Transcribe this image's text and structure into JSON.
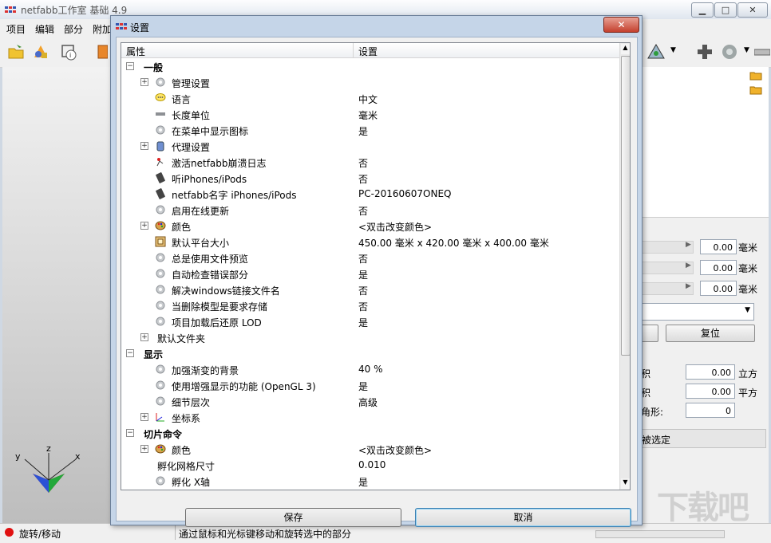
{
  "app": {
    "title": "netfabb工作室 基础 4.9",
    "menus": [
      "项目",
      "编辑",
      "部分",
      "附加"
    ]
  },
  "dialog": {
    "title": "设置",
    "close_label": "✕",
    "columns": {
      "property": "属性",
      "setting": "设置"
    },
    "rows": [
      {
        "label": "一般",
        "value": "",
        "level": 0,
        "type": "section",
        "expander": "−",
        "icon": ""
      },
      {
        "label": "管理设置",
        "value": "",
        "level": 1,
        "type": "item",
        "expander": "+",
        "icon": "gear-icon"
      },
      {
        "label": "语言",
        "value": "中文",
        "level": 1,
        "type": "item",
        "expander": "",
        "icon": "speech-bubble-icon"
      },
      {
        "label": "长度单位",
        "value": "毫米",
        "level": 1,
        "type": "item",
        "expander": "",
        "icon": "ruler-icon"
      },
      {
        "label": "在菜单中显示图标",
        "value": "是",
        "level": 1,
        "type": "item",
        "expander": "",
        "icon": "gear-icon"
      },
      {
        "label": "代理设置",
        "value": "",
        "level": 1,
        "type": "item",
        "expander": "+",
        "icon": "database-icon"
      },
      {
        "label": "激活netfabb崩溃日志",
        "value": "否",
        "level": 1,
        "type": "item",
        "expander": "",
        "icon": "crash-log-icon"
      },
      {
        "label": "听iPhones/iPods",
        "value": "否",
        "level": 1,
        "type": "item",
        "expander": "",
        "icon": "phone-icon"
      },
      {
        "label": "netfabb名字 iPhones/iPods",
        "value": "PC-20160607ONEQ",
        "level": 1,
        "type": "item",
        "expander": "",
        "icon": "phone-icon"
      },
      {
        "label": "启用在线更新",
        "value": "否",
        "level": 1,
        "type": "item",
        "expander": "",
        "icon": "gear-icon"
      },
      {
        "label": "颜色",
        "value": "<双击改变颜色>",
        "level": 1,
        "type": "item",
        "expander": "+",
        "icon": "palette-icon"
      },
      {
        "label": "默认平台大小",
        "value": "450.00 毫米 x 420.00 毫米 x 400.00 毫米",
        "level": 1,
        "type": "item",
        "expander": "",
        "icon": "platform-icon"
      },
      {
        "label": "总是使用文件预览",
        "value": "否",
        "level": 1,
        "type": "item",
        "expander": "",
        "icon": "gear-icon"
      },
      {
        "label": "自动检查错误部分",
        "value": "是",
        "level": 1,
        "type": "item",
        "expander": "",
        "icon": "gear-icon"
      },
      {
        "label": "解决windows链接文件名",
        "value": "否",
        "level": 1,
        "type": "item",
        "expander": "",
        "icon": "gear-icon"
      },
      {
        "label": "当删除模型是要求存储",
        "value": "否",
        "level": 1,
        "type": "item",
        "expander": "",
        "icon": "gear-icon"
      },
      {
        "label": "项目加载后还原 LOD",
        "value": "是",
        "level": 1,
        "type": "item",
        "expander": "",
        "icon": "gear-icon"
      },
      {
        "label": "默认文件夹",
        "value": "",
        "level": 1,
        "type": "item-noicon",
        "expander": "+",
        "icon": ""
      },
      {
        "label": "显示",
        "value": "",
        "level": 0,
        "type": "section",
        "expander": "−",
        "icon": ""
      },
      {
        "label": "加强渐变的背景",
        "value": "40 %",
        "level": 1,
        "type": "item",
        "expander": "",
        "icon": "gear-icon"
      },
      {
        "label": "使用增强显示的功能 (OpenGL 3)",
        "value": "是",
        "level": 1,
        "type": "item",
        "expander": "",
        "icon": "gear-icon"
      },
      {
        "label": "细节层次",
        "value": "高级",
        "level": 1,
        "type": "item",
        "expander": "",
        "icon": "gear-icon"
      },
      {
        "label": "坐标系",
        "value": "",
        "level": 1,
        "type": "item",
        "expander": "+",
        "icon": "axes-icon"
      },
      {
        "label": "切片命令",
        "value": "",
        "level": 0,
        "type": "section",
        "expander": "−",
        "icon": ""
      },
      {
        "label": "颜色",
        "value": "<双击改变颜色>",
        "level": 1,
        "type": "item",
        "expander": "+",
        "icon": "palette-icon"
      },
      {
        "label": "孵化网格尺寸",
        "value": "0.010",
        "level": 1,
        "type": "item-noicon",
        "expander": "",
        "icon": ""
      },
      {
        "label": "孵化 X轴",
        "value": "是",
        "level": 1,
        "type": "item",
        "expander": "",
        "icon": "gear-icon"
      }
    ],
    "buttons": {
      "save": "保存",
      "cancel": "取消"
    }
  },
  "right_panel": {
    "fields": [
      {
        "value": "0.00",
        "unit": "毫米"
      },
      {
        "value": "0.00",
        "unit": "毫米"
      },
      {
        "value": "0.00",
        "unit": "毫米"
      }
    ],
    "reset_label": "复位",
    "stats": [
      {
        "label": "积",
        "value": "0.00",
        "unit": "立方"
      },
      {
        "label": "积",
        "value": "0.00",
        "unit": "平方"
      },
      {
        "label": "角形:",
        "value": "0",
        "unit": ""
      }
    ],
    "selection_label": "被选定"
  },
  "viewport": {
    "axes": {
      "x": "x",
      "y": "y",
      "z": "z"
    }
  },
  "status": {
    "mode": "旋转/移动",
    "hint": "通过鼠标和光标键移动和旋转选中的部分"
  },
  "watermark": "下载吧"
}
